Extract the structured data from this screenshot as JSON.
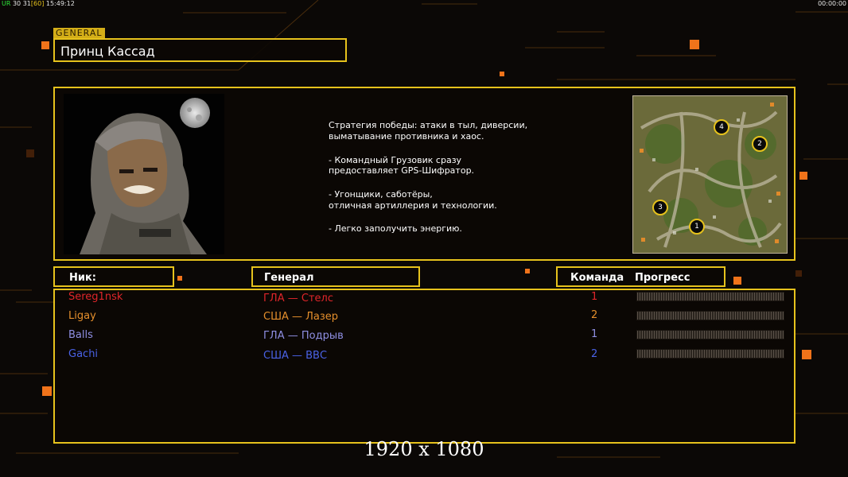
{
  "debug": {
    "left": {
      "tag": "UR",
      "a": "30",
      "b": "31",
      "bracket": "[60]",
      "time": "15:49:12"
    },
    "right": "00:00:00"
  },
  "general": {
    "tag": "GENERAL",
    "name": "Принц Кассад"
  },
  "briefing": {
    "lines": [
      "Стратегия победы: атаки в тыл, диверсии,",
      "выматывание противника и хаос.",
      "- Командный Грузовик сразу",
      "предоставляет GPS-Шифратор.",
      "- Угонщики, саботёры,",
      "отличная артиллерия и технологии.",
      "- Легко заполучить энергию."
    ]
  },
  "minimap": {
    "markers": [
      "4",
      "2",
      "3",
      "1"
    ]
  },
  "headers": {
    "nick": "Ник:",
    "general": "Генерал",
    "team": "Команда",
    "progress": "Прогресс"
  },
  "players": [
    {
      "nick": "Sereg1nsk",
      "general": "ГЛА — Стелс",
      "team": "1",
      "color": "#e0262a",
      "progress": 0
    },
    {
      "nick": "Ligay",
      "general": "США — Лазер",
      "team": "2",
      "color": "#e58f2c",
      "progress": 0
    },
    {
      "nick": "Balls",
      "general": "ГЛА — Подрыв",
      "team": "1",
      "color": "#8f8fe3",
      "progress": 0
    },
    {
      "nick": "Gachi",
      "general": "США — ВВС",
      "team": "2",
      "color": "#4a62e6",
      "progress": 0
    }
  ],
  "resolution": "1920 x 1080"
}
